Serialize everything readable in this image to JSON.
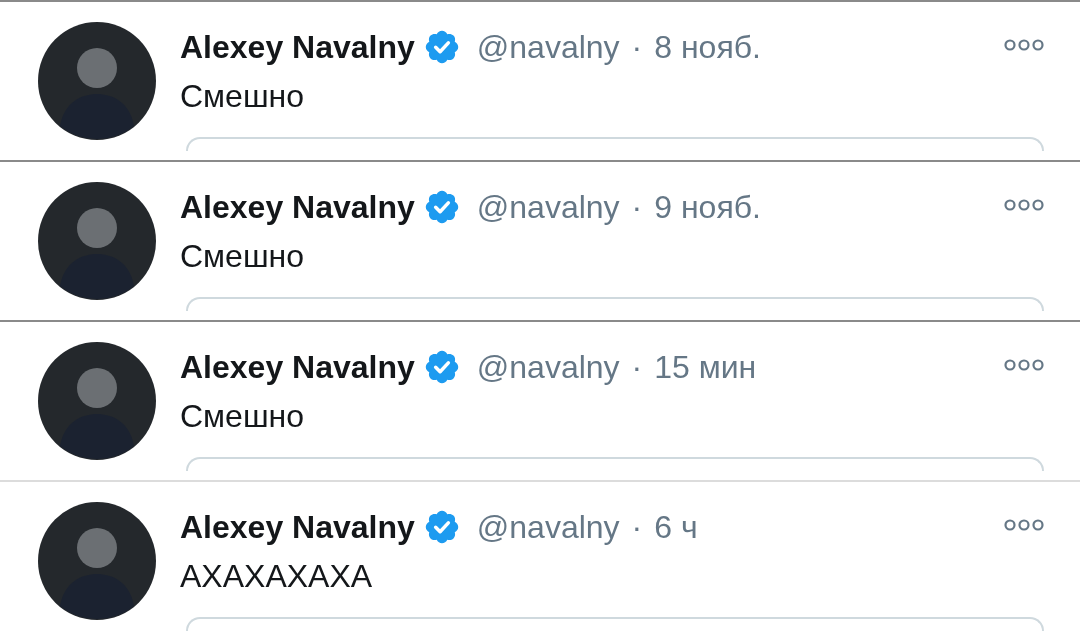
{
  "tweets": [
    {
      "name": "Alexey Navalny",
      "verified": true,
      "handle": "@navalny",
      "separator": "·",
      "time": "8 нояб.",
      "text": "Смешно"
    },
    {
      "name": "Alexey Navalny",
      "verified": true,
      "handle": "@navalny",
      "separator": "·",
      "time": "9 нояб.",
      "text": "Смешно"
    },
    {
      "name": "Alexey Navalny",
      "verified": true,
      "handle": "@navalny",
      "separator": "·",
      "time": "15 мин",
      "text": "Смешно"
    },
    {
      "name": "Alexey Navalny",
      "verified": true,
      "handle": "@navalny",
      "separator": "·",
      "time": "6 ч",
      "text": "АХАХАХАХА"
    }
  ]
}
